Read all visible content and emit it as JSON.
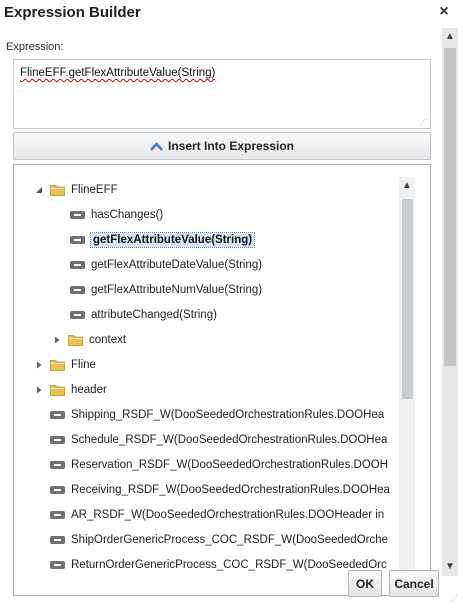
{
  "dialog": {
    "title": "Expression Builder",
    "close_icon": "×"
  },
  "expression": {
    "label": "Expression:",
    "value": "FlineEFF.getFlexAttributeValue(String)"
  },
  "insert_button": {
    "label": "Insert Into Expression",
    "icon": "chevron-up-icon"
  },
  "tree": {
    "nodes": [
      {
        "label": "FlineEFF",
        "type": "folder",
        "expanded": true
      },
      {
        "label": "hasChanges()",
        "type": "function"
      },
      {
        "label": "getFlexAttributeValue(String)",
        "type": "function",
        "selected": true
      },
      {
        "label": "getFlexAttributeDateValue(String)",
        "type": "function"
      },
      {
        "label": "getFlexAttributeNumValue(String)",
        "type": "function"
      },
      {
        "label": "attributeChanged(String)",
        "type": "function"
      },
      {
        "label": "context",
        "type": "folder",
        "expanded": false
      },
      {
        "label": "Fline",
        "type": "folder",
        "expanded": false
      },
      {
        "label": "header",
        "type": "folder",
        "expanded": false
      },
      {
        "label": "Shipping_RSDF_W(DooSeededOrchestrationRules.DOOHea",
        "type": "function"
      },
      {
        "label": "Schedule_RSDF_W(DooSeededOrchestrationRules.DOOHea",
        "type": "function"
      },
      {
        "label": "Reservation_RSDF_W(DooSeededOrchestrationRules.DOOH",
        "type": "function"
      },
      {
        "label": "Receiving_RSDF_W(DooSeededOrchestrationRules.DOOHea",
        "type": "function"
      },
      {
        "label": "AR_RSDF_W(DooSeededOrchestrationRules.DOOHeader in",
        "type": "function"
      },
      {
        "label": "ShipOrderGenericProcess_COC_RSDF_W(DooSeededOrche",
        "type": "function"
      },
      {
        "label": "ReturnOrderGenericProcess_COC_RSDF_W(DooSeededOrc",
        "type": "function"
      }
    ]
  },
  "buttons": {
    "ok_label": "OK",
    "cancel_label": "Cancel"
  },
  "colors": {
    "folder": "#e8c352",
    "selection": "#d6e8fa",
    "accent_icon": "#3f7fd0"
  }
}
